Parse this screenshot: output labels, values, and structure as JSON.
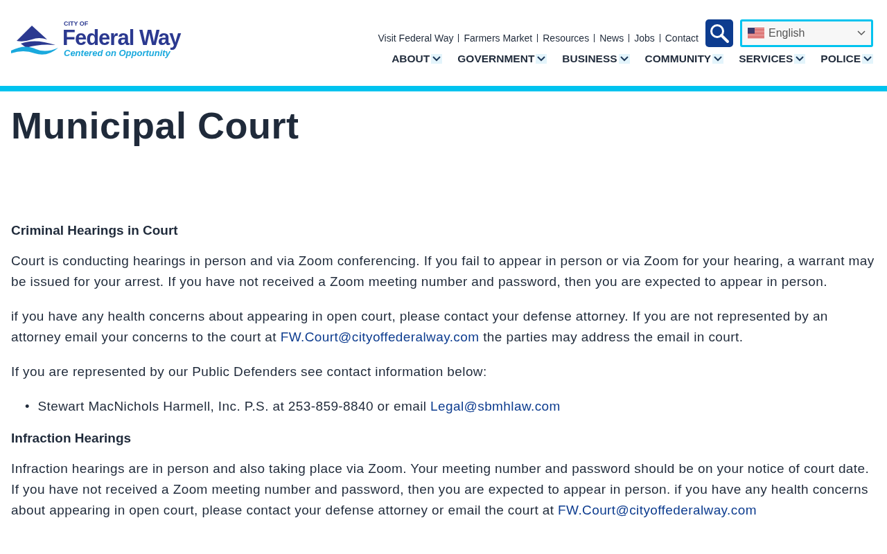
{
  "logo": {
    "city_of": "CITY OF",
    "name": "Federal Way",
    "tagline": "Centered on Opportunity"
  },
  "utility_links": [
    "Visit Federal Way",
    "Farmers Market",
    "Resources",
    "News",
    "Jobs",
    "Contact"
  ],
  "language_select": {
    "value": "English"
  },
  "main_nav": [
    "ABOUT",
    "GOVERNMENT",
    "BUSINESS",
    "COMMUNITY",
    "SERVICES",
    "POLICE"
  ],
  "page_title": "Municipal Court",
  "content": [
    {
      "kind": "heading",
      "text": "Criminal Hearings in Court"
    },
    {
      "kind": "paragraph",
      "parts": [
        {
          "kind": "text",
          "text": "Court is conducting hearings in person and via Zoom conferencing.  If you fail to appear in person or via Zoom for your hearing, a warrant may be issued for your arrest. If you have not received a Zoom meeting number and password, then you are expected to appear in person."
        }
      ]
    },
    {
      "kind": "paragraph",
      "parts": [
        {
          "kind": "text",
          "text": "if you have any health concerns about appearing in open court, please contact your defense attorney. If you are not represented by an attorney email your concerns to the court at "
        },
        {
          "kind": "link",
          "text": "FW.Court@cityoffederalway.com"
        },
        {
          "kind": "text",
          "text": "  the parties may address the email in court."
        }
      ]
    },
    {
      "kind": "paragraph",
      "parts": [
        {
          "kind": "text",
          "text": "If you are represented by our Public Defenders see contact information below:"
        }
      ]
    },
    {
      "kind": "bullet",
      "marker": "•",
      "parts": [
        {
          "kind": "text",
          "text": "Stewart MacNichols Harmell, Inc. P.S. at 253-859-8840 or email "
        },
        {
          "kind": "link",
          "text": "Legal@sbmhlaw.com"
        }
      ]
    },
    {
      "kind": "heading",
      "text": "Infraction Hearings"
    },
    {
      "kind": "paragraph",
      "parts": [
        {
          "kind": "text",
          "text": "Infraction hearings are in person and also taking place via Zoom.  Your meeting number and password should be on your notice of court date. If you have not received a Zoom meeting number and password, then you are expected to appear in person. if you have any health concerns about appearing in open court, please contact your defense attorney or email the court at "
        },
        {
          "kind": "link",
          "text": "FW.Court@cityoffederalway.com"
        }
      ]
    }
  ]
}
